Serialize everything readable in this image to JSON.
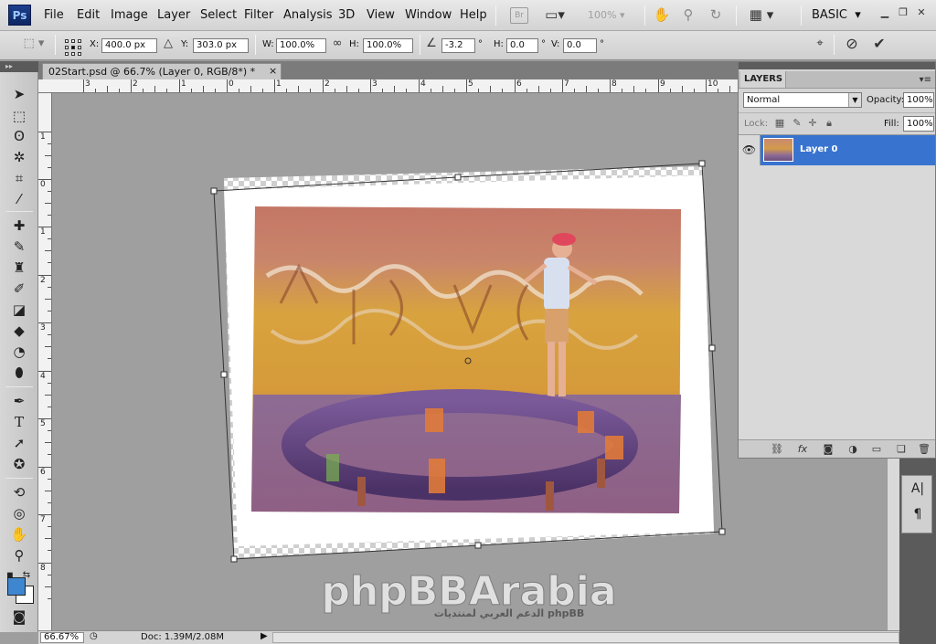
{
  "app": {
    "logo": "Ps"
  },
  "menu": [
    "File",
    "Edit",
    "Image",
    "Layer",
    "Select",
    "Filter",
    "Analysis",
    "3D",
    "View",
    "Window",
    "Help"
  ],
  "menubar": {
    "bridge_label": "Br",
    "zoom": "100%",
    "workspace": "BASIC",
    "icons": [
      "bridge-icon",
      "screen-mode-icon",
      "hand-icon",
      "zoom-icon",
      "rotate-view-icon",
      "arrange-icon"
    ]
  },
  "options": {
    "x_label": "X:",
    "x_value": "400.0 px",
    "y_label": "Y:",
    "y_value": "303.0 px",
    "w_label": "W:",
    "w_value": "100.0%",
    "h_label": "H:",
    "h_value": "100.0%",
    "angle_value": "-3.2",
    "hskew_label": "H:",
    "hskew_value": "0.0",
    "vskew_label": "V:",
    "vskew_value": "0.0",
    "degree": "°"
  },
  "document": {
    "tab_title": "02Start.psd @ 66.7% (Layer 0, RGB/8*) *",
    "tab_close": "×"
  },
  "rulers": {
    "top": [
      "3",
      "2",
      "1",
      "0",
      "1",
      "2",
      "3",
      "4",
      "5",
      "6",
      "7",
      "8",
      "9",
      "10"
    ],
    "left": [
      "1",
      "0",
      "1",
      "2",
      "3",
      "4",
      "5",
      "6",
      "7",
      "8"
    ]
  },
  "status": {
    "zoom": "66.67%",
    "doc_info": "Doc: 1.39M/2.08M"
  },
  "layers_panel": {
    "tab": "LAYERS",
    "blend_mode": "Normal",
    "opacity_label": "Opacity:",
    "opacity_value": "100%",
    "lock_label": "Lock:",
    "fill_label": "Fill:",
    "fill_value": "100%",
    "layers": [
      {
        "name": "Layer 0",
        "visible": true,
        "selected": true
      }
    ]
  },
  "watermark": {
    "title": "phpBBArabia",
    "subtitle": "الدعم العربي لمنتديات phpBB"
  },
  "colors": {
    "foreground": "#3f86d0",
    "background": "#ffffff",
    "selection": "#3874cf"
  }
}
